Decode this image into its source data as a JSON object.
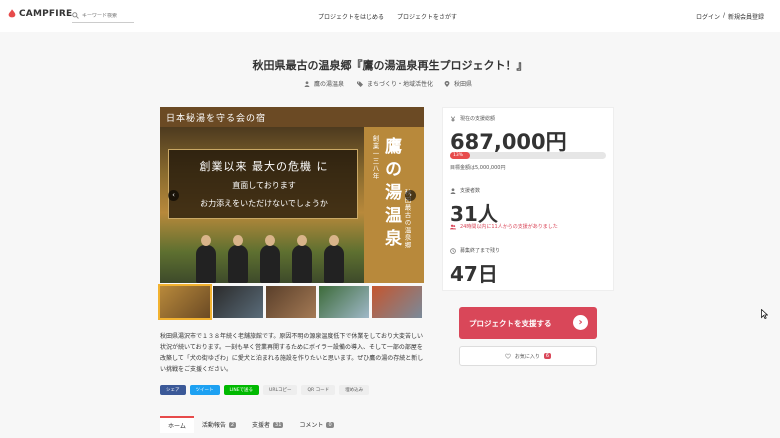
{
  "header": {
    "logo": "CAMPFIRE",
    "search_placeholder": "キーワード検索",
    "nav_start": "プロジェクトをはじめる",
    "nav_search": "プロジェクトをさがす",
    "login": "ログイン",
    "sep": "/",
    "register": "新規会員登録"
  },
  "project": {
    "title": "秋田県最古の温泉郷『鷹の湯温泉再生プロジェクト！』",
    "owner": "鷹の湯温泉",
    "category": "まちづくり・地域活性化",
    "location": "秋田県"
  },
  "hero": {
    "top_caption": "日本秘湯を守る会の宿",
    "banner_line1": "創業以来 最大の危機 に",
    "banner_line2": "直面しております",
    "banner_line3": "お力添えをいただけないでしょうか",
    "side_main": "鷹の湯温泉",
    "side_sub1": "創業一三八年",
    "side_sub2": "秋田最古の温泉郷"
  },
  "description": "秋田県湯沢市で１３８年続く老舗旅館です。原因不明の源泉温度低下で休業をしており大変苦しい状況が続いております。一刻も早く営業再開するためにボイラー設備の導入、そして一部の部屋を改築して「犬の街ゆざわ」に愛犬と泊まれる施設を作りたいと思います。ぜひ鷹の湯の存続と新しい挑戦をご支援ください。",
  "share": {
    "facebook": "シェア",
    "twitter": "ツイート",
    "line": "LINEで送る",
    "url": "URLコピー",
    "qr": "QR コード",
    "embed": "埋め込み"
  },
  "tabs": [
    {
      "label": "ホーム",
      "count": ""
    },
    {
      "label": "活動報告",
      "count": "2"
    },
    {
      "label": "支援者",
      "count": "31"
    },
    {
      "label": "コメント",
      "count": "0"
    }
  ],
  "stats": {
    "current_label": "現在の支援総額",
    "amount": "687,000円",
    "progress_percent": 13,
    "progress_label": "13%",
    "goal": "目標金額は5,000,000円",
    "backers_label": "支援者数",
    "backers": "31人",
    "recent_note": "24時間以内に11人からの支援がありました",
    "remaining_label": "募集終了まで残り",
    "remaining": "47日"
  },
  "actions": {
    "support": "プロジェクトを支援する",
    "favorite": "お気に入り",
    "favorite_count": "6"
  },
  "colors": {
    "accent": "#d94759",
    "brand": "#e74b4b",
    "facebook": "#3b5998",
    "twitter": "#1da1f2",
    "line": "#00b900"
  }
}
